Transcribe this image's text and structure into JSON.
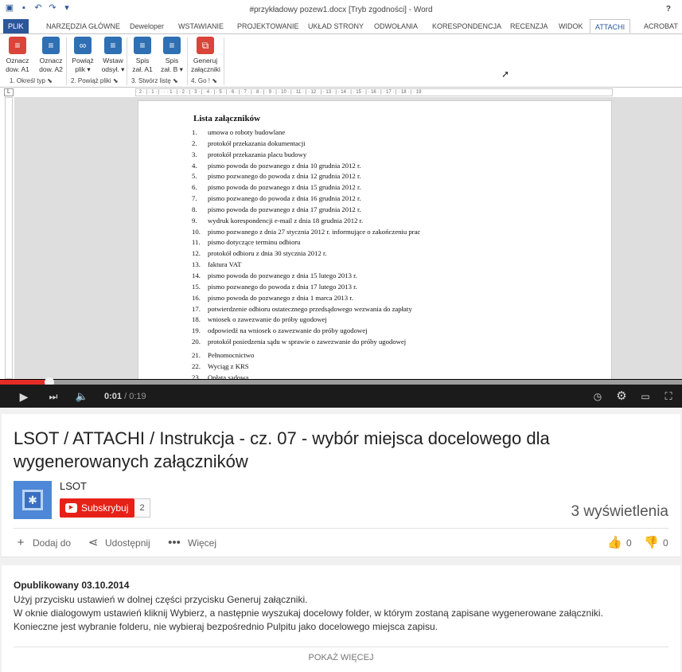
{
  "word": {
    "window_title": "#przykładowy pozew1.docx [Tryb zgodności] - Word",
    "help": "?",
    "ribbon_tabs": [
      "PLIK",
      "NARZĘDZIA GŁÓWNE",
      "Deweloper",
      "WSTAWIANIE",
      "PROJEKTOWANIE",
      "UKŁAD STRONY",
      "ODWOŁANIA",
      "KORESPONDENCJA",
      "RECENZJA",
      "WIDOK",
      "ATTACHI",
      "ACROBAT"
    ],
    "active_tab": "ATTACHI",
    "buttons": [
      {
        "line1": "Oznacz",
        "line2": "dow. A1",
        "icon": "doc-icon"
      },
      {
        "line1": "Oznacz",
        "line2": "dow. A2",
        "icon": "doc-icon"
      },
      {
        "line1": "Powiąż",
        "line2": "plik ▾",
        "icon": "link-icon"
      },
      {
        "line1": "Wstaw",
        "line2": "odsył. ▾",
        "icon": "insert-icon"
      },
      {
        "line1": "Spis",
        "line2": "zał. A1",
        "icon": "list-icon"
      },
      {
        "line1": "Spis",
        "line2": "zał. B ▾",
        "icon": "list-icon"
      },
      {
        "line1": "Generuj",
        "line2": "załączniki",
        "icon": "generate-icon"
      }
    ],
    "groups": [
      "1. Określ typ",
      "2. Powiąż pliki",
      "3. Stwórz listę",
      "4. Go !"
    ],
    "ruler_text": "· 2 · | · 1 · | · · · 1 · | · 2 · | · 3 · | · 4 · | · 5 · | · 6 · | · 7 · | · 8 · | · 9 · | · 10 · | · 11 · | · 12 · | · 13 · | · 14 · | · 15 · | · 16 · | · 17 · | · 18 · | · 19",
    "document": {
      "heading": "Lista załączników",
      "items": [
        "umowa o roboty budowlane",
        "protokół przekazania dokumentacji",
        "protokół przekazania placu budowy",
        "pismo powoda do pozwanego z dnia 10 grudnia 2012 r.",
        "pismo pozwanego do powoda z dnia 12 grudnia 2012 r.",
        "pismo powoda do pozwanego z dnia 15 grudnia 2012 r.",
        "pismo pozwanego do powoda z dnia 16 grudnia 2012 r.",
        "pismo powoda do pozwanego z dnia 17 grudnia 2012 r.",
        "wydruk korespondencji e-mail z dnia 18 grudnia 2012 r.",
        "pismo pozwanego z dnia 27 stycznia 2012 r. informujące o zakończeniu prac",
        "pismo dotyczące terminu odbioru",
        "protokół odbioru z dnia 30 stycznia 2012 r.",
        "faktura VAT",
        "pismo powoda do pozwanego z dnia 15 lutego 2013 r.",
        "pismo pozwanego do powoda z dnia 17 lutego 2013 r.",
        "pismo powoda do pozwanego z dnia 1 marca 2013 r.",
        "potwierdzenie odbioru ostatecznego przedsądowego wezwania do zapłaty",
        "wniosek o zawezwanie do próby ugodowej",
        "odpowiedź na wniosek o zawezwanie do próby ugodowej",
        "protokół posiedzenia sądu w sprawie o zawezwanie do próby ugodowej",
        "Pełnomocnictwo",
        "Wyciąg z KRS",
        "Opłata sądowa"
      ]
    }
  },
  "player": {
    "time_current": "0:01",
    "time_total": "/ 0:19",
    "played_fraction": 0.072,
    "loaded_fraction": 1.0
  },
  "video": {
    "title": "LSOT / ATTACHI / Instrukcja - cz. 07 - wybór miejsca docelowego dla wygenerowanych załączników",
    "channel": "LSOT",
    "subscribe_label": "Subskrybuj",
    "subscriber_count": "2",
    "views": "3 wyświetlenia",
    "actions": {
      "add": "Dodaj do",
      "share": "Udostępnij",
      "more": "Więcej"
    },
    "likes": "0",
    "dislikes": "0"
  },
  "description": {
    "published": "Opublikowany 03.10.2014",
    "lines": [
      "Użyj przycisku ustawień w dolnej części przycisku Generuj załączniki.",
      "W oknie dialogowym ustawień kliknij Wybierz, a następnie wyszukaj docelowy folder, w którym zostaną zapisane wygenerowane załączniki.",
      "Konieczne jest wybranie folderu, nie wybieraj bezpośrednio Pulpitu jako docelowego miejsca zapisu."
    ],
    "show_more": "POKAŻ WIĘCEJ"
  },
  "colors": {
    "accent_red": "#e62117",
    "word_blue": "#2b579a"
  }
}
